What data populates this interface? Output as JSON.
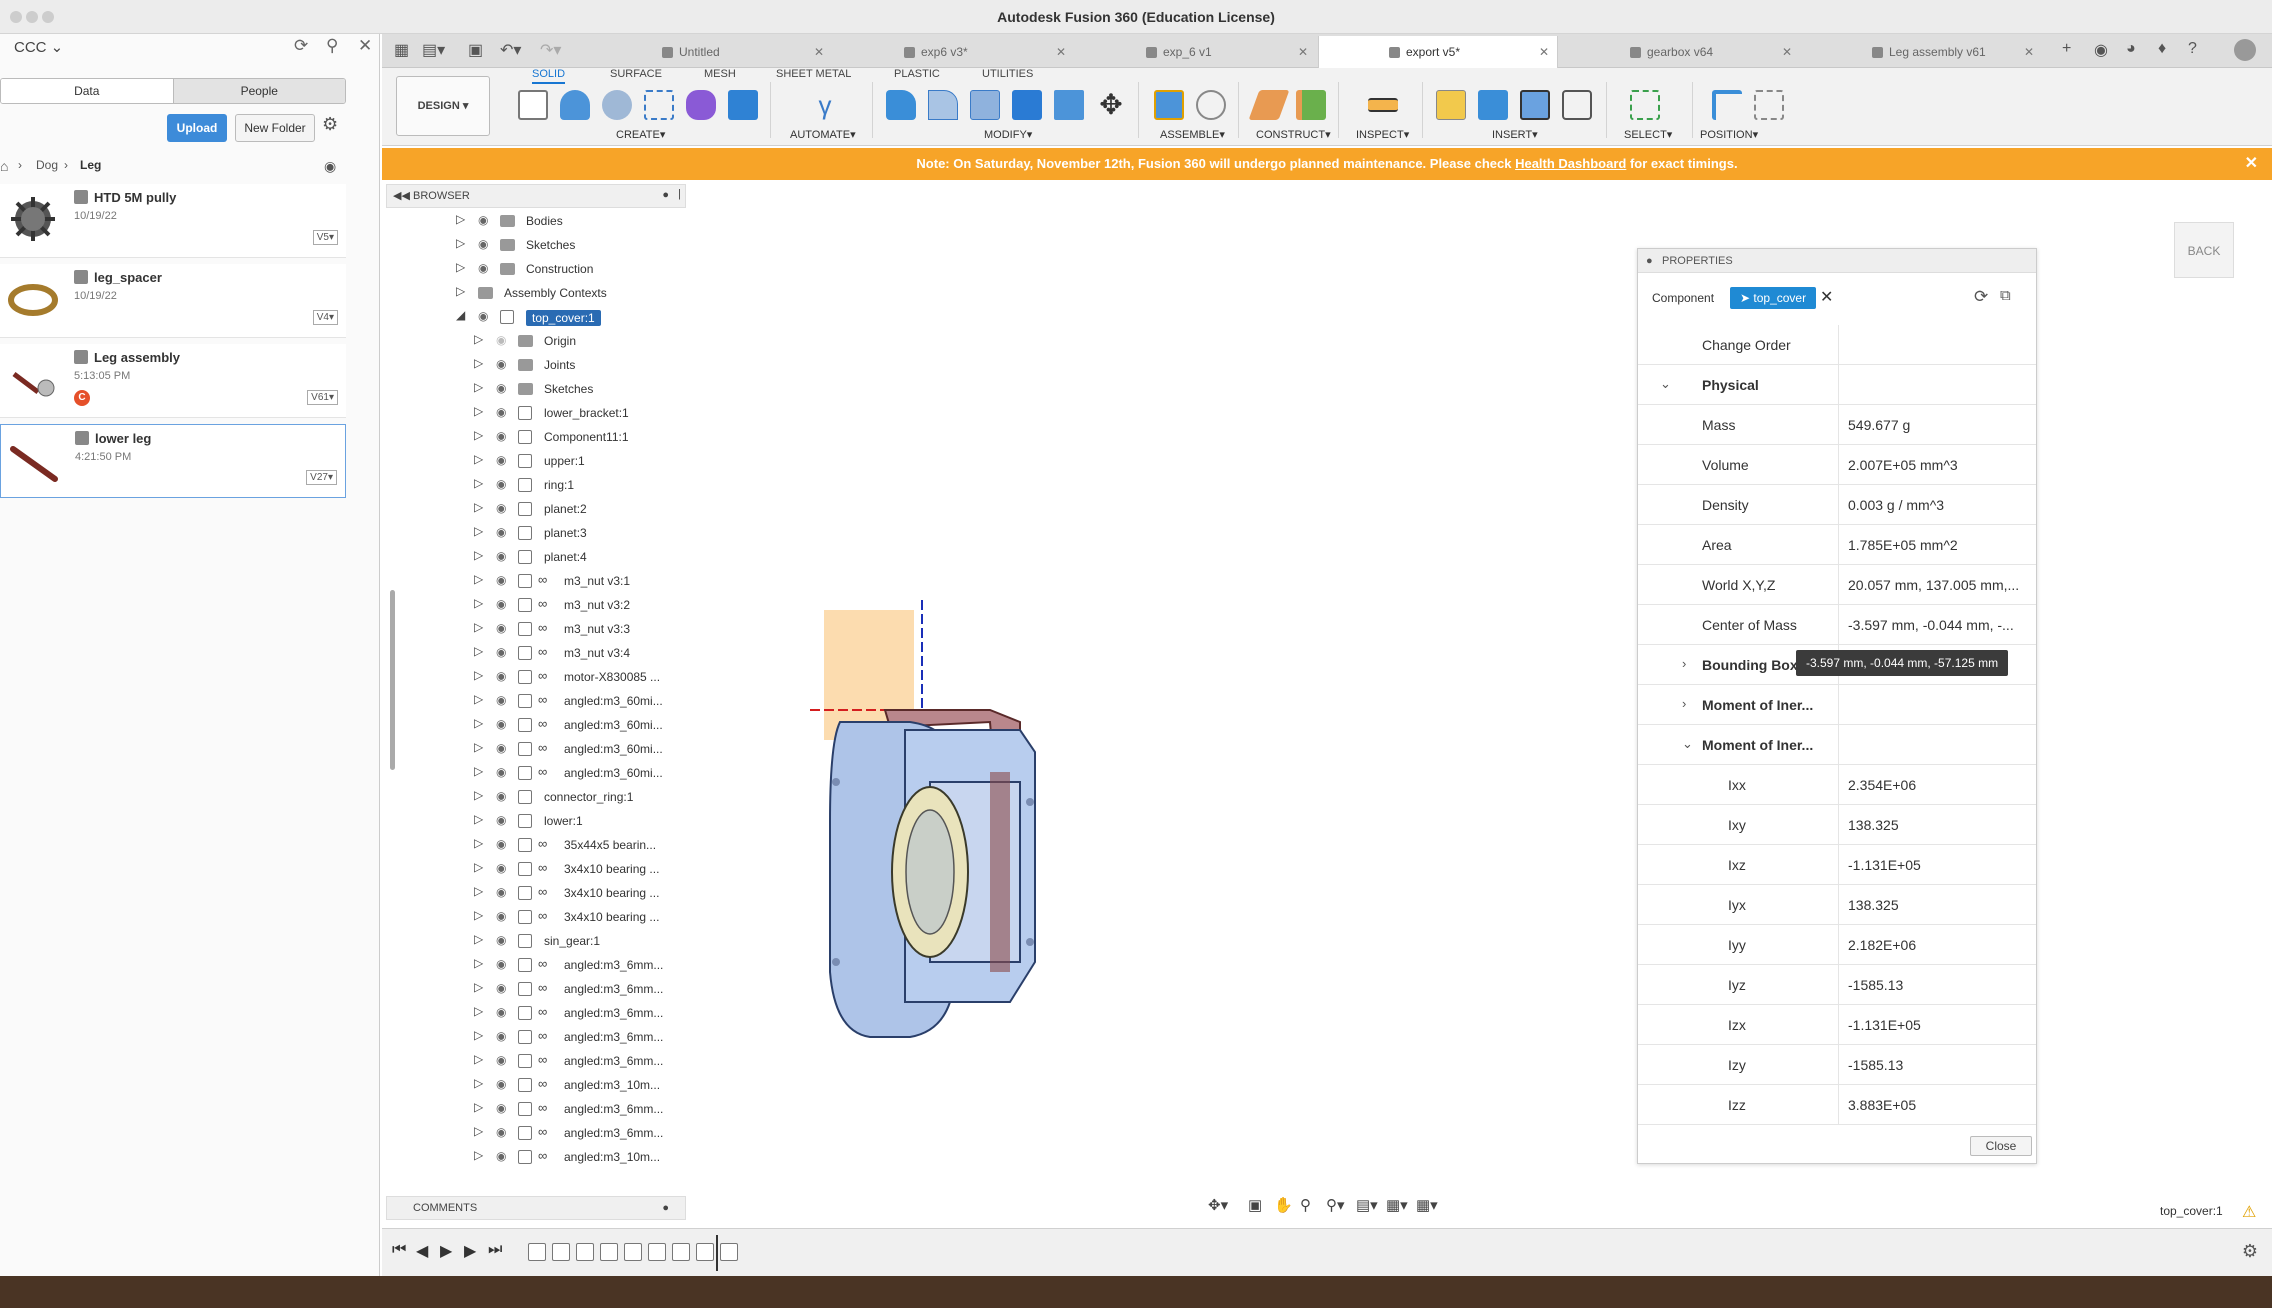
{
  "window": {
    "title": "Autodesk Fusion 360 (Education License)"
  },
  "data_panel": {
    "team": "CCC",
    "tab_data": "Data",
    "tab_people": "People",
    "upload": "Upload",
    "new_folder": "New Folder",
    "breadcrumb": [
      "Dog",
      "Leg"
    ],
    "files": [
      {
        "name": "HTD 5M pully",
        "date": "10/19/22",
        "version": "V5"
      },
      {
        "name": "leg_spacer",
        "date": "10/19/22",
        "version": "V4"
      },
      {
        "name": "Leg assembly",
        "date": "5:13:05 PM",
        "version": "V61",
        "badge": "C"
      },
      {
        "name": "lower leg",
        "date": "4:21:50 PM",
        "version": "V27"
      }
    ]
  },
  "tabs": [
    {
      "label": "Untitled"
    },
    {
      "label": "exp6 v3*"
    },
    {
      "label": "exp_6 v1"
    },
    {
      "label": "export v5*"
    },
    {
      "label": "gearbox v64"
    },
    {
      "label": "Leg assembly v61"
    }
  ],
  "ribbon": {
    "workspace": "DESIGN",
    "tabs": [
      "SOLID",
      "SURFACE",
      "MESH",
      "SHEET METAL",
      "PLASTIC",
      "UTILITIES"
    ],
    "groups": [
      "CREATE",
      "AUTOMATE",
      "MODIFY",
      "ASSEMBLE",
      "CONSTRUCT",
      "INSPECT",
      "INSERT",
      "SELECT",
      "POSITION"
    ]
  },
  "banner": {
    "text_before": "Note: On Saturday, November 12th, Fusion 360 will undergo planned maintenance. Please check ",
    "link": "Health Dashboard",
    "text_after": " for exact timings."
  },
  "browser": {
    "title": "BROWSER",
    "items": [
      {
        "label": "Bodies",
        "type": "folder",
        "level": 0
      },
      {
        "label": "Sketches",
        "type": "folder",
        "level": 0
      },
      {
        "label": "Construction",
        "type": "folder",
        "level": 0
      },
      {
        "label": "Assembly Contexts",
        "type": "folder",
        "level": 0
      },
      {
        "label": "top_cover:1",
        "type": "component",
        "level": 0,
        "selected": true
      },
      {
        "label": "Origin",
        "type": "folder",
        "level": 1
      },
      {
        "label": "Joints",
        "type": "folder",
        "level": 1
      },
      {
        "label": "Sketches",
        "type": "folder",
        "level": 1
      },
      {
        "label": "lower_bracket:1",
        "type": "component",
        "level": 1
      },
      {
        "label": "Component11:1",
        "type": "component",
        "level": 1
      },
      {
        "label": "upper:1",
        "type": "component",
        "level": 1
      },
      {
        "label": "ring:1",
        "type": "component",
        "level": 1
      },
      {
        "label": "planet:2",
        "type": "component",
        "level": 1
      },
      {
        "label": "planet:3",
        "type": "component",
        "level": 1
      },
      {
        "label": "planet:4",
        "type": "component",
        "level": 1
      },
      {
        "label": "m3_nut v3:1",
        "type": "link",
        "level": 1
      },
      {
        "label": "m3_nut v3:2",
        "type": "link",
        "level": 1
      },
      {
        "label": "m3_nut v3:3",
        "type": "link",
        "level": 1
      },
      {
        "label": "m3_nut v3:4",
        "type": "link",
        "level": 1
      },
      {
        "label": "motor-X830085 ...",
        "type": "link",
        "level": 1
      },
      {
        "label": "angled:m3_60mi...",
        "type": "link",
        "level": 1
      },
      {
        "label": "angled:m3_60mi...",
        "type": "link",
        "level": 1
      },
      {
        "label": "angled:m3_60mi...",
        "type": "link",
        "level": 1
      },
      {
        "label": "angled:m3_60mi...",
        "type": "link",
        "level": 1
      },
      {
        "label": "connector_ring:1",
        "type": "component",
        "level": 1
      },
      {
        "label": "lower:1",
        "type": "component",
        "level": 1
      },
      {
        "label": "35x44x5 bearin...",
        "type": "link",
        "level": 1
      },
      {
        "label": "3x4x10 bearing ...",
        "type": "link",
        "level": 1
      },
      {
        "label": "3x4x10 bearing ...",
        "type": "link",
        "level": 1
      },
      {
        "label": "3x4x10 bearing ...",
        "type": "link",
        "level": 1
      },
      {
        "label": "sin_gear:1",
        "type": "component",
        "level": 1
      },
      {
        "label": "angled:m3_6mm...",
        "type": "link",
        "level": 1
      },
      {
        "label": "angled:m3_6mm...",
        "type": "link",
        "level": 1
      },
      {
        "label": "angled:m3_6mm...",
        "type": "link",
        "level": 1
      },
      {
        "label": "angled:m3_6mm...",
        "type": "link",
        "level": 1
      },
      {
        "label": "angled:m3_6mm...",
        "type": "link",
        "level": 1
      },
      {
        "label": "angled:m3_10m...",
        "type": "link",
        "level": 1
      },
      {
        "label": "angled:m3_6mm...",
        "type": "link",
        "level": 1
      },
      {
        "label": "angled:m3_6mm...",
        "type": "link",
        "level": 1
      },
      {
        "label": "angled:m3_10m...",
        "type": "link",
        "level": 1
      }
    ]
  },
  "properties": {
    "title": "PROPERTIES",
    "component_label": "Component",
    "component_chip": "top_cover",
    "rows": [
      {
        "key": "Change Order",
        "value": "",
        "kind": "plain"
      },
      {
        "key": "Physical",
        "value": "",
        "kind": "section-open"
      },
      {
        "key": "Mass",
        "value": "549.677 g",
        "kind": "plain"
      },
      {
        "key": "Volume",
        "value": "2.007E+05 mm^3",
        "kind": "plain"
      },
      {
        "key": "Density",
        "value": "0.003 g / mm^3",
        "kind": "plain"
      },
      {
        "key": "Area",
        "value": "1.785E+05 mm^2",
        "kind": "plain"
      },
      {
        "key": "World X,Y,Z",
        "value": "20.057 mm, 137.005 mm,...",
        "kind": "plain"
      },
      {
        "key": "Center of Mass",
        "value": "-3.597 mm, -0.044 mm, -...",
        "kind": "plain"
      },
      {
        "key": "Bounding Box",
        "value": "",
        "kind": "section-closed"
      },
      {
        "key": "Moment of Iner...",
        "value": "",
        "kind": "section-closed"
      },
      {
        "key": "Moment of Iner...",
        "value": "",
        "kind": "section-open"
      },
      {
        "key": "Ixx",
        "value": "2.354E+06",
        "kind": "sub"
      },
      {
        "key": "Ixy",
        "value": "138.325",
        "kind": "sub"
      },
      {
        "key": "Ixz",
        "value": "-1.131E+05",
        "kind": "sub"
      },
      {
        "key": "Iyx",
        "value": "138.325",
        "kind": "sub"
      },
      {
        "key": "Iyy",
        "value": "2.182E+06",
        "kind": "sub"
      },
      {
        "key": "Iyz",
        "value": "-1585.13",
        "kind": "sub"
      },
      {
        "key": "Izx",
        "value": "-1.131E+05",
        "kind": "sub"
      },
      {
        "key": "Izy",
        "value": "-1585.13",
        "kind": "sub"
      },
      {
        "key": "Izz",
        "value": "3.883E+05",
        "kind": "sub"
      }
    ],
    "tooltip": "-3.597 mm, -0.044 mm, -57.125 mm",
    "close": "Close"
  },
  "viewcube": {
    "label": "BACK"
  },
  "comments": {
    "title": "COMMENTS"
  },
  "status": {
    "component": "top_cover:1"
  }
}
